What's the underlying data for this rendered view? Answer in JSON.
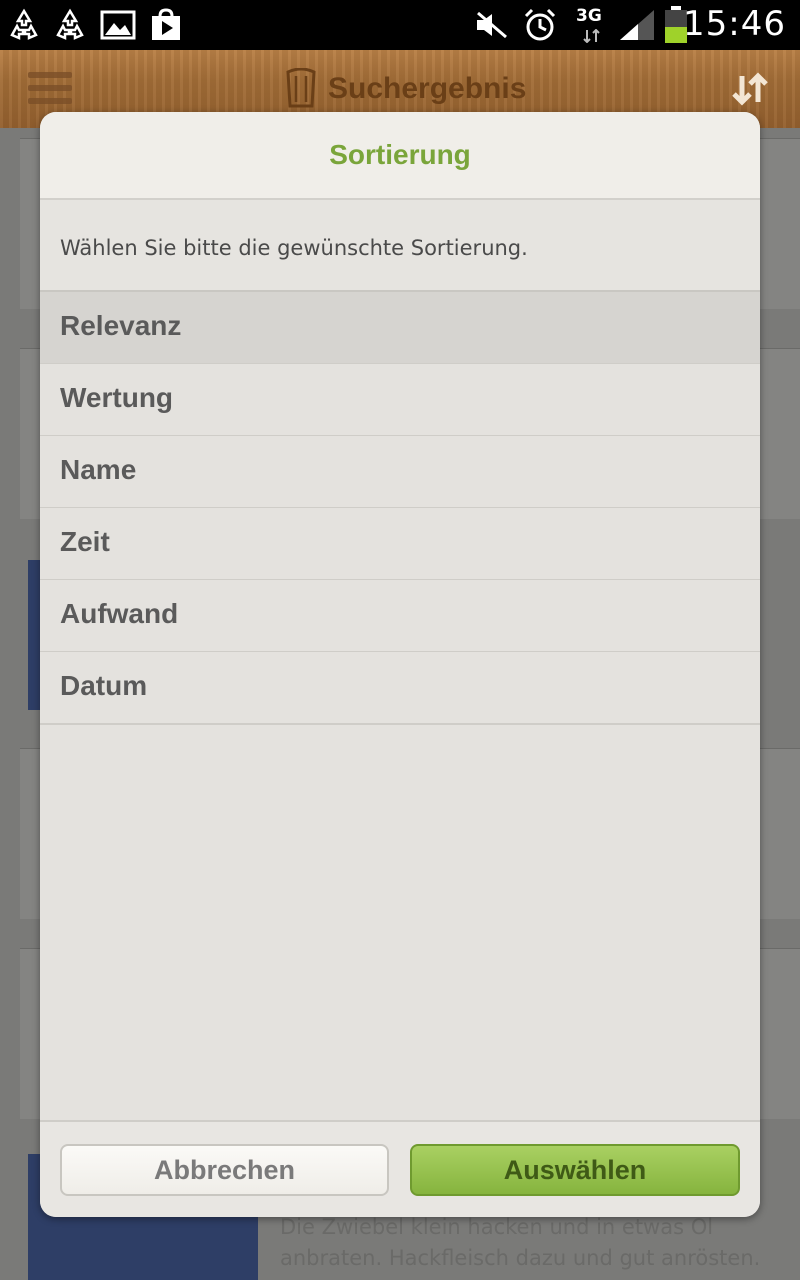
{
  "status_bar": {
    "time": "15:46",
    "network": "3G",
    "icons": [
      "recycle-icon",
      "recycle-icon",
      "image-icon",
      "play-store-icon",
      "mute-icon",
      "alarm-icon",
      "signal-icon",
      "battery-icon"
    ]
  },
  "action_bar": {
    "title": "Suchergebnis",
    "icons": [
      "menu-icon",
      "chef-hat-icon",
      "sort-icon"
    ]
  },
  "background": {
    "visible_text_line1": "Die Zwiebel klein hacken und in etwas Öl",
    "visible_text_line2": "anbraten. Hackfleisch dazu und gut anrösten."
  },
  "dialog": {
    "title": "Sortierung",
    "message": "Wählen Sie bitte die gewünschte Sortierung.",
    "options": [
      {
        "label": "Relevanz",
        "selected": true
      },
      {
        "label": "Wertung",
        "selected": false
      },
      {
        "label": "Name",
        "selected": false
      },
      {
        "label": "Zeit",
        "selected": false
      },
      {
        "label": "Aufwand",
        "selected": false
      },
      {
        "label": "Datum",
        "selected": false
      }
    ],
    "cancel_label": "Abbrechen",
    "confirm_label": "Auswählen"
  },
  "colors": {
    "accent_green": "#7aa53a",
    "wood_brown": "#a26d37"
  }
}
